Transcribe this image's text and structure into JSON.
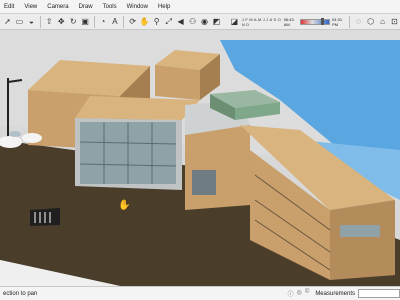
{
  "menu": {
    "items": [
      "Edit",
      "View",
      "Camera",
      "Draw",
      "Tools",
      "Window",
      "Help"
    ]
  },
  "toolbar": {
    "icons": [
      "select-icon",
      "eraser-icon",
      "paint-bucket-icon",
      "push-pull-icon",
      "move-icon",
      "rotate-icon",
      "offset-icon",
      "tape-measure-icon",
      "text-icon",
      "orbit-icon",
      "pan-icon",
      "zoom-icon",
      "zoom-extents-icon",
      "previous-view-icon",
      "walk-icon",
      "look-around-icon",
      "section-plane-icon"
    ],
    "months": "J F M A M J J A S O N D",
    "time_start": "06:43 AM",
    "time_mid": "Noon",
    "time_end": "04:31 PM",
    "right_icons": [
      "shadows-toggle-icon",
      "fog-icon",
      "iso-view-icon",
      "top-view-icon",
      "front-view-icon",
      "right-view-icon"
    ]
  },
  "status": {
    "message": "ection to pan",
    "measurements_label": "Measurements",
    "measurements_value": "",
    "icons": [
      "info-icon",
      "geo-location-icon",
      "credits-icon"
    ]
  },
  "colors": {
    "ground": "#4a3e2b",
    "sidewalk": "#e6e8ea",
    "water": "#5aa6e0",
    "sand_stone": "#d8b27a",
    "roof": "#d9b47f",
    "glass": "#8fa2a8"
  }
}
